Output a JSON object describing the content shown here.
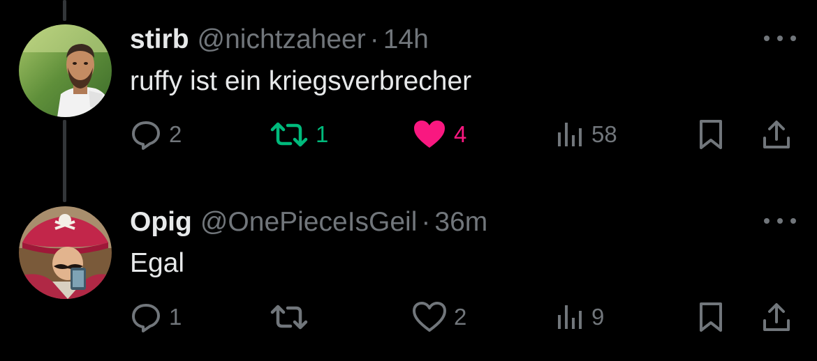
{
  "tweets": [
    {
      "display_name": "stirb",
      "handle": "@nichtzaheer",
      "separator": "·",
      "time": "14h",
      "text": "ruffy ist ein kriegsverbrecher",
      "replies": "2",
      "retweets": "1",
      "likes": "4",
      "views": "58",
      "retweeted": true,
      "liked": true
    },
    {
      "display_name": "Opig",
      "handle": "@OnePieceIsGeil",
      "separator": "·",
      "time": "36m",
      "text": "Egal",
      "replies": "1",
      "retweets": "",
      "likes": "2",
      "views": "9",
      "retweeted": false,
      "liked": false
    }
  ],
  "icons": {
    "reply": "speech-bubble-icon",
    "retweet": "retweet-arrows-icon",
    "like": "heart-icon",
    "views": "bar-chart-icon",
    "bookmark": "bookmark-icon",
    "share": "share-upload-icon",
    "more": "three-dots-icon"
  },
  "colors": {
    "background": "#000000",
    "text_primary": "#e7e9ea",
    "text_secondary": "#71767b",
    "retweet_active": "#00ba7c",
    "like_active": "#f91880",
    "thread_line": "#333639"
  }
}
